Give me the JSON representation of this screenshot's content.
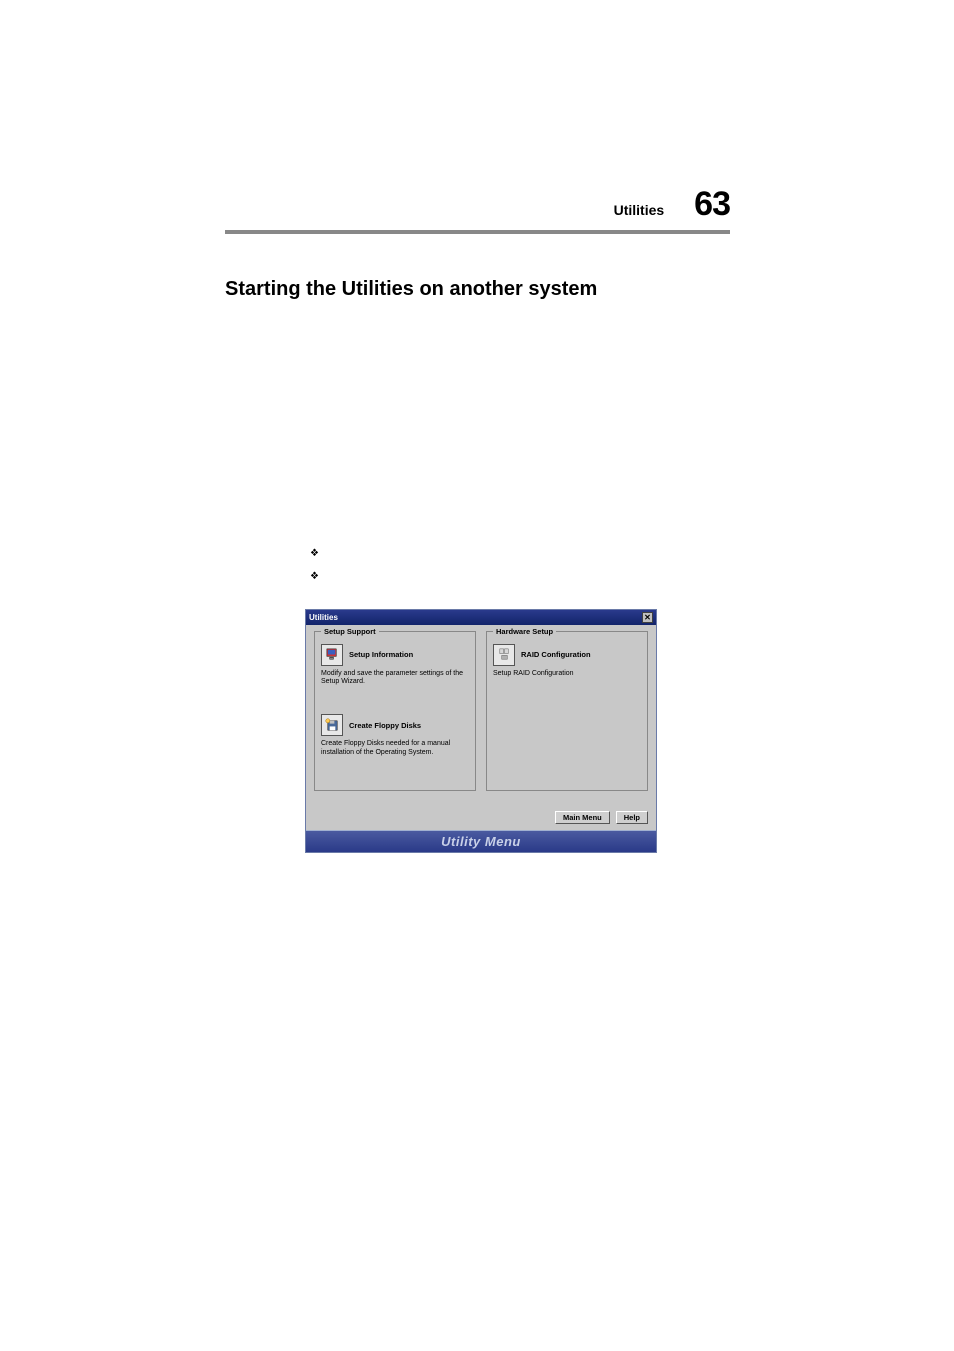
{
  "header": {
    "section": "Utilities",
    "page_number": "63"
  },
  "heading": "Starting the Utilities on another system",
  "bullets": [
    "",
    ""
  ],
  "dialog": {
    "title": "Utilities",
    "close_label": "✕",
    "groups": {
      "left": {
        "legend": "Setup Support",
        "items": [
          {
            "title": "Setup Information",
            "desc": "Modify and save the parameter settings of the Setup Wizard."
          },
          {
            "title": "Create Floppy Disks",
            "desc": "Create Floppy Disks needed for a manual installation of the Operating System."
          }
        ]
      },
      "right": {
        "legend": "Hardware Setup",
        "items": [
          {
            "title": "RAID Configuration",
            "desc": "Setup RAID Configuration"
          }
        ]
      }
    },
    "buttons": {
      "main_menu": "Main Menu",
      "help": "Help"
    },
    "footer": "Utility Menu"
  }
}
